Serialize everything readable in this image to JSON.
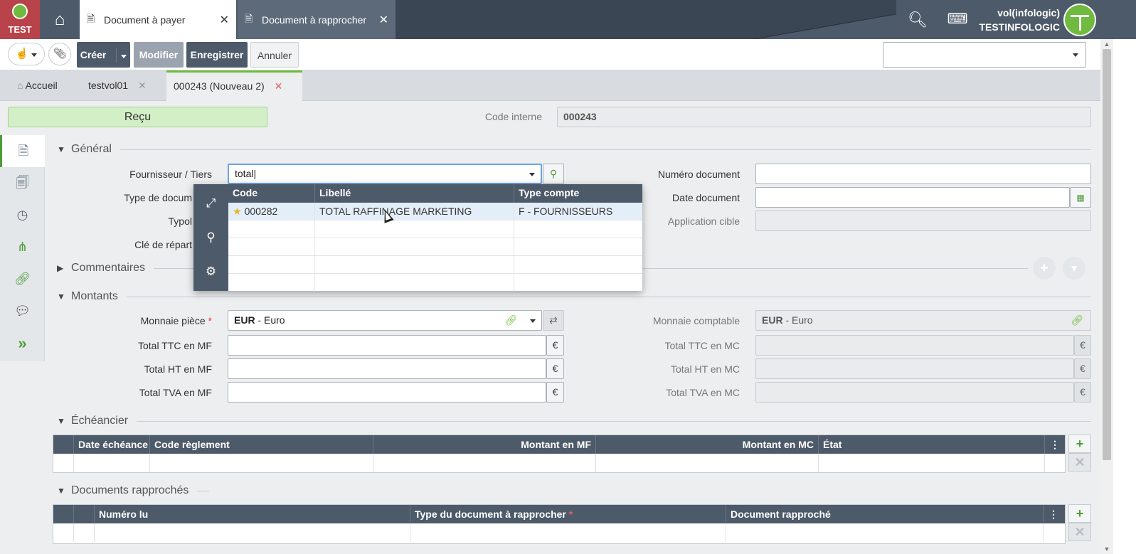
{
  "app": {
    "env_label": "TEST",
    "tabs": [
      {
        "label": "Document à payer"
      },
      {
        "label": "Document à rapprocher"
      }
    ],
    "user_line1": "vol(infologic)",
    "user_line2": "TESTINFOLOGIC",
    "accent": "#6fba3f",
    "primary": "#4d5a6a"
  },
  "toolbar": {
    "create_label": "Créer",
    "modify_label": "Modifier",
    "save_label": "Enregistrer",
    "cancel_label": "Annuler",
    "select_value": ""
  },
  "doc_tabs": [
    {
      "label": "Accueil"
    },
    {
      "label": "testvol01"
    },
    {
      "label": "000243 (Nouveau 2)"
    }
  ],
  "header": {
    "status": "Reçu",
    "code_interne_label": "Code interne",
    "code_interne_value": "000243"
  },
  "sections": {
    "general": "Général",
    "commentaires": "Commentaires",
    "montants": "Montants",
    "echeancier": "Échéancier",
    "documents": "Documents rapprochés"
  },
  "general": {
    "fournisseur_label": "Fournisseur / Tiers",
    "fournisseur_value": "total",
    "type_doc_label": "Type de docum",
    "typologie_label": "Typol",
    "cle_label": "Clé de répart",
    "numero_label": "Numéro document",
    "numero_value": "",
    "date_label": "Date document",
    "date_value": "",
    "app_cible_label": "Application cible",
    "app_cible_value": ""
  },
  "dropdown": {
    "columns": [
      "Code",
      "Libellé",
      "Type compte"
    ],
    "rows": [
      {
        "code": "000282",
        "libelle": "TOTAL RAFFINAGE MARKETING",
        "type": "F - FOURNISSEURS"
      }
    ]
  },
  "montants": {
    "monnaie_piece_label": "Monnaie pièce",
    "monnaie_piece_code": "EUR",
    "monnaie_piece_name": " - Euro",
    "monnaie_compta_label": "Monnaie comptable",
    "monnaie_compta_code": "EUR",
    "monnaie_compta_name": " - Euro",
    "ttc_mf_label": "Total TTC en MF",
    "ht_mf_label": "Total HT en MF",
    "tva_mf_label": "Total TVA en MF",
    "ttc_mc_label": "Total TTC en MC",
    "ht_mc_label": "Total HT en MC",
    "tva_mc_label": "Total TVA en MC",
    "currency_symbol": "€"
  },
  "echeancier": {
    "columns": [
      "Date échéance",
      "Code règlement",
      "Montant en MF",
      "Montant en MC",
      "État"
    ]
  },
  "documents": {
    "columns": [
      "Numéro lu",
      "Type du document à rapprocher",
      "Document rapproché"
    ]
  }
}
